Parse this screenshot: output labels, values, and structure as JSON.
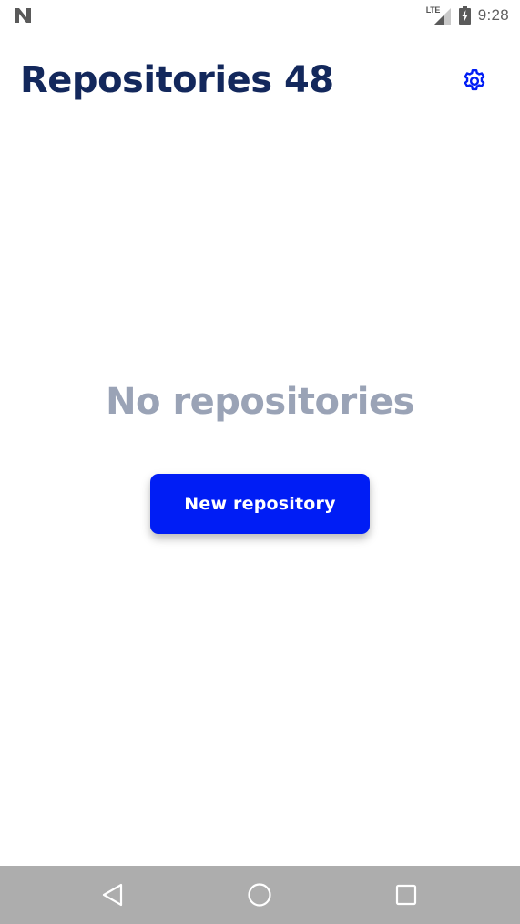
{
  "status_bar": {
    "network_label": "LTE",
    "time": "9:28"
  },
  "header": {
    "title": "Repositories 48",
    "settings_icon": "gear-icon"
  },
  "empty_state": {
    "message": "No repositories",
    "button_label": "New repository"
  },
  "nav_bar": {
    "icons": [
      "back-icon",
      "home-icon",
      "recents-icon"
    ]
  },
  "colors": {
    "title": "#13285c",
    "accent": "#001df5",
    "empty_text": "#9aa3b6",
    "nav_bar": "#adadad"
  }
}
